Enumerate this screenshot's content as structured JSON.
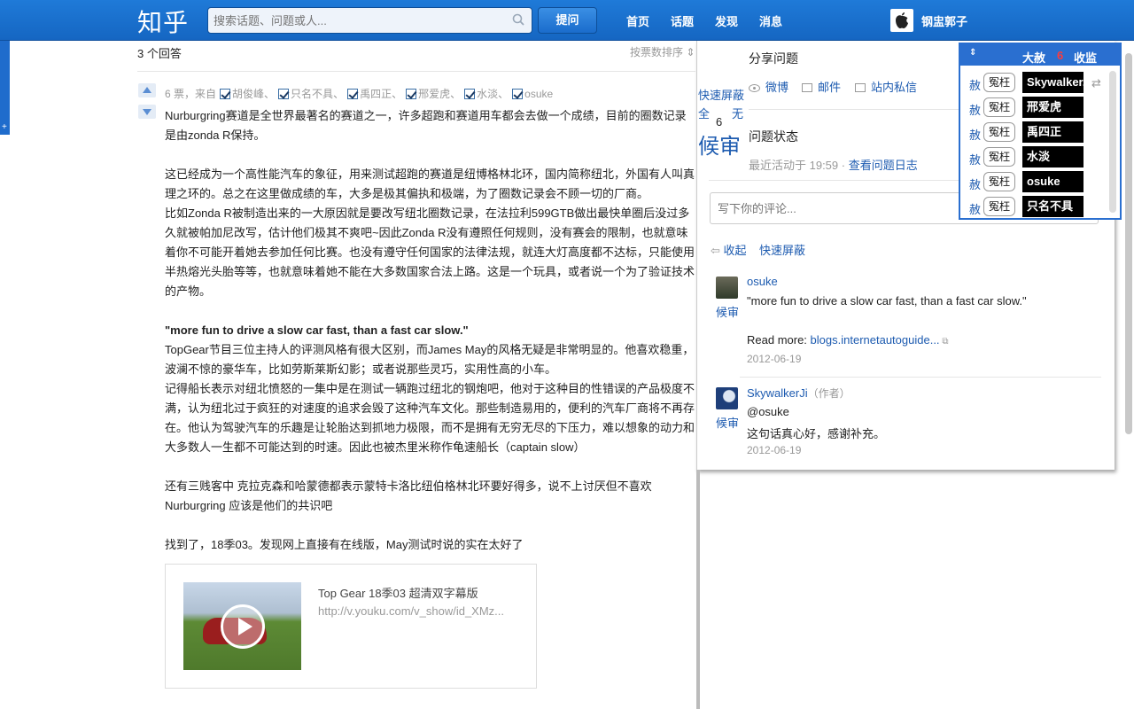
{
  "header": {
    "logo": "知乎",
    "search_placeholder": "搜索话题、问题或人...",
    "ask_label": "提问",
    "nav": [
      "首页",
      "话题",
      "发现",
      "消息"
    ],
    "user_name": "钢盅郭子"
  },
  "left_tab": {
    "label": "+"
  },
  "answers": {
    "count_label": "3 个回答",
    "sort_label": "按票数排序 ⇕",
    "votes_prefix": "6 票，来自",
    "voters": [
      "胡俊峰",
      "只名不具",
      "禹四正",
      "邢爱虎",
      "水淡",
      "osuke"
    ],
    "paragraphs": [
      "Nurburgring赛道是全世界最著名的赛道之一，许多超跑和赛道用车都会去做一个成绩，目前的圈数记录是由zonda R保持。",
      "",
      "这已经成为一个高性能汽车的象征，用来测试超跑的赛道是纽博格林北环，国内简称纽北，外国有人叫真理之环的。总之在这里做成绩的车，大多是极其偏执和极端，为了圈数记录会不顾一切的厂商。",
      "比如Zonda R被制造出来的一大原因就是要改写纽北圈数记录，在法拉利599GTB做出最快单圈后没过多久就被帕加尼改写，估计他们极其不爽吧~因此Zonda R没有遵照任何规则，没有赛会的限制，也就意味着你不可能开着她去参加任何比赛。也没有遵守任何国家的法律法规，就连大灯高度都不达标，只能使用半热熔光头胎等等，也就意味着她不能在大多数国家合法上路。这是一个玩具，或者说一个为了验证技术的产物。",
      "",
      "\"more fun to drive a slow car fast, than a fast car slow.\"",
      "TopGear节目三位主持人的评测风格有很大区别，而James May的风格无疑是非常明显的。他喜欢稳重，波澜不惊的豪华车，比如劳斯莱斯幻影；或者说那些灵巧，实用性高的小车。",
      "记得船长表示对纽北愤怒的一集中是在测试一辆跑过纽北的钢炮吧，他对于这种目的性错误的产品极度不满，认为纽北过于疯狂的对速度的追求会毁了这种汽车文化。那些制造易用的，便利的汽车厂商将不再存在。他认为驾驶汽车的乐趣是让轮胎达到抓地力极限，而不是拥有无穷无尽的下压力，难以想象的动力和大多数人一生都不可能达到的时速。因此也被杰里米称作龟速船长（captain slow）",
      "",
      "还有三贱客中 克拉克森和哈蒙德都表示蒙特卡洛比纽伯格林北环要好得多，说不上讨厌但不喜欢Nurburgring 应该是他们的共识吧",
      "",
      "找到了，18季03。发现网上直接有在线版，May测试时说的实在太好了"
    ],
    "video_title": "Top Gear 18季03 超清双字幕版",
    "video_url": "http://v.youku.com/v_show/id_XMz..."
  },
  "side": {
    "quick_block": "快速屏蔽",
    "all": "全",
    "none": "无",
    "number": "6",
    "big": "候审"
  },
  "right": {
    "share_title": "分享问题",
    "share_items": [
      "微博",
      "邮件",
      "站内私信"
    ],
    "status_title": "问题状态",
    "status_prefix": "最近活动于 19:59 · ",
    "status_link": "查看问题日志",
    "comment_placeholder": "写下你的评论...",
    "collapse": "收起",
    "quick_block": "快速屏蔽",
    "comments": [
      {
        "badge": "候审",
        "author": "osuke",
        "role": "",
        "text": "\"more fun to drive a slow car fast, than a fast car slow.\"",
        "read_more_prefix": "Read more: ",
        "read_more_link": "blogs.internetautoguide...",
        "date": "2012-06-19"
      },
      {
        "badge": "候审",
        "author": "SkywalkerJi",
        "role": "（作者）",
        "text": "@osuke",
        "text2": "这句话真心好，感谢补充。",
        "date": "2012-06-19"
      }
    ]
  },
  "blocker": {
    "sort_icon": "⇕",
    "title": "大赦",
    "count": "6",
    "collect": "收监",
    "pardon": "赦",
    "wrong": "冤枉",
    "names": [
      "Skywalker.",
      "邢爱虎",
      "禹四正",
      "水淡",
      "osuke",
      "只名不具"
    ],
    "swap": "⇄"
  }
}
